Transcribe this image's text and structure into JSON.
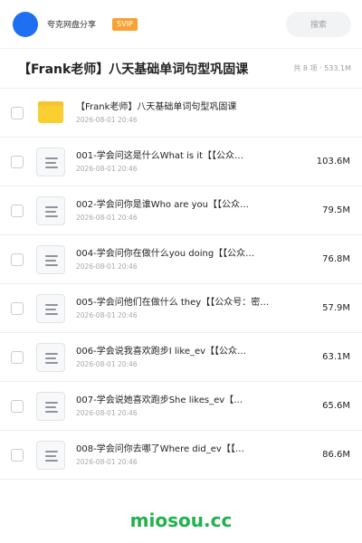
{
  "header": {
    "brand": "夸克网盘分享",
    "badge": "SVIP",
    "search_label": "搜索"
  },
  "title_row": {
    "title": "【Frank老师】八天基础单词句型巩固课",
    "meta": "共 8 项 · 533.1M"
  },
  "items": [
    {
      "kind": "folder",
      "name": "【Frank老师】八天基础单词句型巩固课",
      "date": "2026-08-01 20:46",
      "size": ""
    },
    {
      "kind": "file",
      "name": "001-学会问这是什么What is it【【公众…",
      "date": "2026-08-01 20:46",
      "size": "103.6M"
    },
    {
      "kind": "file",
      "name": "002-学会问你是谁Who are you【【公众…",
      "date": "2026-08-01 20:46",
      "size": "79.5M"
    },
    {
      "kind": "file",
      "name": "004-学会问你在做什么you doing【【公众…",
      "date": "2026-08-01 20:46",
      "size": "76.8M"
    },
    {
      "kind": "file",
      "name": "005-学会问他们在做什么 they【【公众号：密…",
      "date": "2026-08-01 20:46",
      "size": "57.9M"
    },
    {
      "kind": "file",
      "name": "006-学会说我喜欢跑步I like_ev【【公众…",
      "date": "2026-08-01 20:46",
      "size": "63.1M"
    },
    {
      "kind": "file",
      "name": "007-学会说她喜欢跑步She likes_ev【…",
      "date": "2026-08-01 20:46",
      "size": "65.6M"
    },
    {
      "kind": "file",
      "name": "008-学会问你去哪了Where did_ev【【…",
      "date": "2026-08-01 20:46",
      "size": "86.6M"
    }
  ],
  "watermark": "miosou.cc",
  "colors": {
    "avatar": "#1f6ff2",
    "badge": "#f7a233",
    "folder": "#f9cf31",
    "watermark": "#20b24b"
  },
  "icons": {
    "folder": "folder-icon",
    "file": "document-icon"
  }
}
